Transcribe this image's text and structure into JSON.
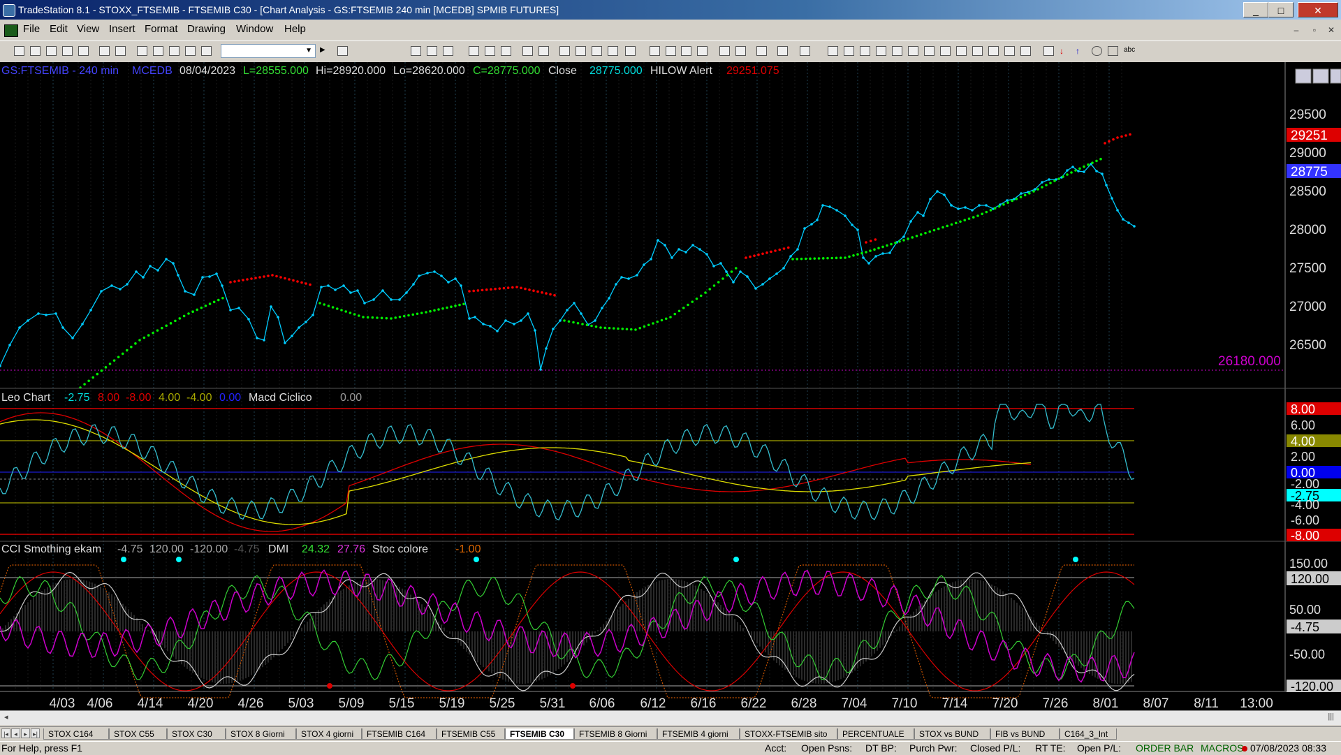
{
  "window": {
    "title": "TradeStation 8.1 - STOXX_FTSEMIB - FTSEMIB C30 - [Chart Analysis - GS:FTSEMIB  240 min  [MCEDB] SPMIB FUTURES]",
    "minimize": "_",
    "maximize": "□",
    "close": "✕"
  },
  "menu": {
    "items": [
      "File",
      "Edit",
      "View",
      "Insert",
      "Format",
      "Drawing",
      "Window",
      "Help"
    ],
    "mdi_buttons": [
      "–",
      "▫",
      "✕"
    ]
  },
  "toolbar": {
    "symbol_value": ""
  },
  "price_panel": {
    "header": {
      "symbol": "GS:FTSEMIB - 240 min",
      "source": "MCEDB",
      "date": "08/04/2023",
      "low": "L=28555.000",
      "high": "Hi=28920.000",
      "lo": "Lo=28620.000",
      "close": "C=28775.000",
      "close_label": "Close",
      "close_value": "28775.000",
      "alert_label": "HILOW Alert",
      "alert_value": "29251.075"
    },
    "axis_ticks": [
      "29500",
      "29000",
      "28500",
      "28000",
      "27500",
      "27000",
      "26500"
    ],
    "markers": {
      "red": "29251",
      "blue": "28775"
    },
    "level_line_label": "26180.000"
  },
  "osc_panel": {
    "header": {
      "name": "Leo Chart",
      "v1": "-2.75",
      "v2": "8.00",
      "v3": "-8.00",
      "v4": "4.00",
      "v5": "-4.00",
      "v6": "0.00",
      "name2": "Macd Ciclico",
      "v7": "0.00"
    },
    "axis_ticks": [
      "6.00",
      "2.00",
      "-2.00",
      "-4.00",
      "-6.00"
    ],
    "markers": {
      "top": "8.00",
      "mid": "4.00",
      "zero": "0.00",
      "value": "-2.75",
      "bottom": "-8.00"
    }
  },
  "cci_panel": {
    "header": {
      "name": "CCI Smothing ekam",
      "v1": "-4.75",
      "v2": "120.00",
      "v3": "-120.00",
      "v4": "-4.75",
      "dmi": "DMI",
      "v5": "24.32",
      "v6": "27.76",
      "stoc": "Stoc colore",
      "v7": "-1.00"
    },
    "axis_ticks": [
      "150.00",
      "50.00",
      "-50.00"
    ],
    "markers": {
      "upper": "120.00",
      "value": "-4.75",
      "lower": "-120.00"
    }
  },
  "x_axis": {
    "labels": [
      "4/03",
      "4/06",
      "4/14",
      "4/20",
      "4/26",
      "5/03",
      "5/09",
      "5/15",
      "5/19",
      "5/25",
      "5/31",
      "6/06",
      "6/12",
      "6/16",
      "6/22",
      "6/28",
      "7/04",
      "7/10",
      "7/14",
      "7/20",
      "7/26",
      "8/01",
      "8/07",
      "8/11",
      "13:00"
    ]
  },
  "tabs": {
    "items": [
      "STOX C164",
      "STOX C55",
      "STOX  C30",
      "STOX  8 Giorni",
      "STOX 4 giorni",
      "FTSEMIB C164",
      "FTSEMIB C55",
      "FTSEMIB C30",
      "FTSEMIB  8 Giorni",
      "FTSEMIB  4 giorni",
      "STOXX-FTSEMIB sito",
      "PERCENTUALE",
      "STOX vs BUND",
      "FIB vs BUND",
      "C164_3_Int"
    ],
    "active": 7,
    "nav": [
      "|◂",
      "◂",
      "▸",
      "▸|"
    ]
  },
  "status": {
    "help": "For Help, press F1",
    "acct": "Acct:",
    "open_psns": "Open Psns:",
    "dt_bp": "DT BP:",
    "purch_pwr": "Purch Pwr:",
    "closed_pl": "Closed P/L:",
    "rt_te": "RT TE:",
    "open_pl": "Open P/L:",
    "order_bar": "ORDER BAR",
    "macros": "MACROS",
    "datetime": "07/08/2023 08:33"
  },
  "colors": {
    "price": "#00ccff",
    "green_dots": "#00ee00",
    "red_dots": "#ff0000",
    "yellow": "#dddd00",
    "cyan": "#00ffff",
    "magenta": "#cc00cc",
    "background": "#000000"
  }
}
